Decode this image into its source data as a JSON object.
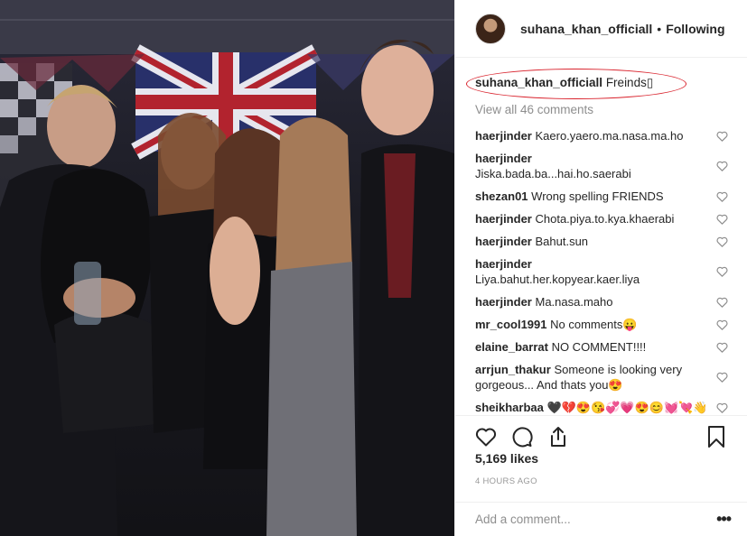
{
  "post": {
    "username": "suhana_khan_officiall",
    "follow_separator": "•",
    "follow_status": "Following",
    "caption_user": "suhana_khan_officiall",
    "caption_text": "Freinds▯",
    "view_all": "View all 46 comments",
    "likes": "5,169 likes",
    "time": "4 HOURS AGO",
    "add_comment_placeholder": "Add a comment...",
    "more": "•••"
  },
  "comments": [
    {
      "user": "haerjinder",
      "text": "Kaero.yaero.ma.nasa.ma.ho"
    },
    {
      "user": "haerjinder",
      "text": "Jiska.bada.ba...hai.ho.saerabi",
      "wrap": true
    },
    {
      "user": "shezan01",
      "text": "Wrong spelling FRIENDS"
    },
    {
      "user": "haerjinder",
      "text": "Chota.piya.to.kya.khaerabi"
    },
    {
      "user": "haerjinder",
      "text": "Bahut.sun"
    },
    {
      "user": "haerjinder",
      "text": "Liya.bahut.her.kopyear.kaer.liya",
      "wrap": true
    },
    {
      "user": "haerjinder",
      "text": "Ma.nasa.maho"
    },
    {
      "user": "mr_cool1991",
      "text": "No comments😛"
    },
    {
      "user": "elaine_barrat",
      "text": "NO COMMENT!!!!"
    },
    {
      "user": "arrjun_thakur",
      "text": "Someone is looking very gorgeous... And thats you😍"
    },
    {
      "user": "sheikharbaa",
      "text": "🖤💔😍😘💞💗😍😊💓💘👋"
    }
  ],
  "icons": {
    "like": "heart-icon",
    "comment": "comment-icon",
    "share": "share-icon",
    "save": "bookmark-icon"
  },
  "colors": {
    "annotation_oval": "#d9232d",
    "muted_text": "#8e8e8e"
  }
}
